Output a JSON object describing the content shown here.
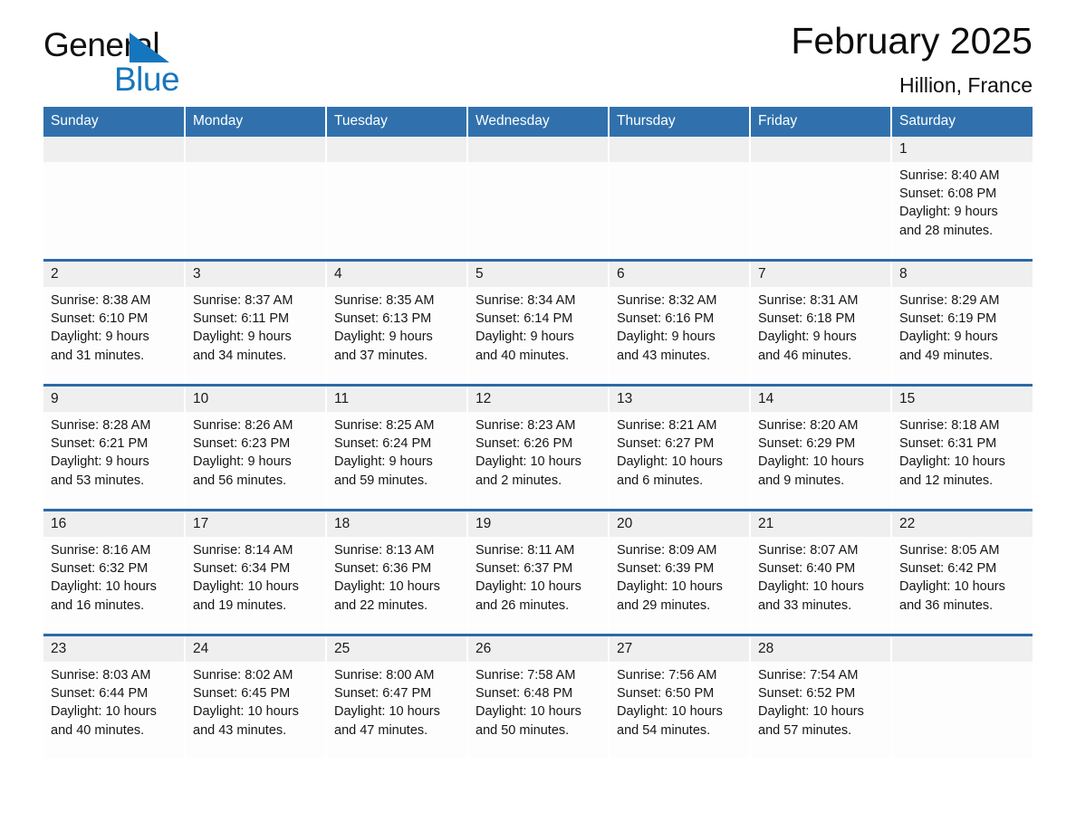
{
  "brand": {
    "name_part1": "General",
    "name_part2": "Blue",
    "triangle_color": "#1676bd"
  },
  "header": {
    "title": "February 2025",
    "subtitle": "Hillion, France",
    "header_bg": "#3071ad",
    "row_divider_color": "#2b6aa8",
    "daynum_bg": "#efefef"
  },
  "weekday_headers": [
    "Sunday",
    "Monday",
    "Tuesday",
    "Wednesday",
    "Thursday",
    "Friday",
    "Saturday"
  ],
  "weeks": [
    [
      {
        "day": "",
        "sunrise": "",
        "sunset": "",
        "daylight_line1": "",
        "daylight_line2": ""
      },
      {
        "day": "",
        "sunrise": "",
        "sunset": "",
        "daylight_line1": "",
        "daylight_line2": ""
      },
      {
        "day": "",
        "sunrise": "",
        "sunset": "",
        "daylight_line1": "",
        "daylight_line2": ""
      },
      {
        "day": "",
        "sunrise": "",
        "sunset": "",
        "daylight_line1": "",
        "daylight_line2": ""
      },
      {
        "day": "",
        "sunrise": "",
        "sunset": "",
        "daylight_line1": "",
        "daylight_line2": ""
      },
      {
        "day": "",
        "sunrise": "",
        "sunset": "",
        "daylight_line1": "",
        "daylight_line2": ""
      },
      {
        "day": "1",
        "sunrise": "Sunrise: 8:40 AM",
        "sunset": "Sunset: 6:08 PM",
        "daylight_line1": "Daylight: 9 hours",
        "daylight_line2": "and 28 minutes."
      }
    ],
    [
      {
        "day": "2",
        "sunrise": "Sunrise: 8:38 AM",
        "sunset": "Sunset: 6:10 PM",
        "daylight_line1": "Daylight: 9 hours",
        "daylight_line2": "and 31 minutes."
      },
      {
        "day": "3",
        "sunrise": "Sunrise: 8:37 AM",
        "sunset": "Sunset: 6:11 PM",
        "daylight_line1": "Daylight: 9 hours",
        "daylight_line2": "and 34 minutes."
      },
      {
        "day": "4",
        "sunrise": "Sunrise: 8:35 AM",
        "sunset": "Sunset: 6:13 PM",
        "daylight_line1": "Daylight: 9 hours",
        "daylight_line2": "and 37 minutes."
      },
      {
        "day": "5",
        "sunrise": "Sunrise: 8:34 AM",
        "sunset": "Sunset: 6:14 PM",
        "daylight_line1": "Daylight: 9 hours",
        "daylight_line2": "and 40 minutes."
      },
      {
        "day": "6",
        "sunrise": "Sunrise: 8:32 AM",
        "sunset": "Sunset: 6:16 PM",
        "daylight_line1": "Daylight: 9 hours",
        "daylight_line2": "and 43 minutes."
      },
      {
        "day": "7",
        "sunrise": "Sunrise: 8:31 AM",
        "sunset": "Sunset: 6:18 PM",
        "daylight_line1": "Daylight: 9 hours",
        "daylight_line2": "and 46 minutes."
      },
      {
        "day": "8",
        "sunrise": "Sunrise: 8:29 AM",
        "sunset": "Sunset: 6:19 PM",
        "daylight_line1": "Daylight: 9 hours",
        "daylight_line2": "and 49 minutes."
      }
    ],
    [
      {
        "day": "9",
        "sunrise": "Sunrise: 8:28 AM",
        "sunset": "Sunset: 6:21 PM",
        "daylight_line1": "Daylight: 9 hours",
        "daylight_line2": "and 53 minutes."
      },
      {
        "day": "10",
        "sunrise": "Sunrise: 8:26 AM",
        "sunset": "Sunset: 6:23 PM",
        "daylight_line1": "Daylight: 9 hours",
        "daylight_line2": "and 56 minutes."
      },
      {
        "day": "11",
        "sunrise": "Sunrise: 8:25 AM",
        "sunset": "Sunset: 6:24 PM",
        "daylight_line1": "Daylight: 9 hours",
        "daylight_line2": "and 59 minutes."
      },
      {
        "day": "12",
        "sunrise": "Sunrise: 8:23 AM",
        "sunset": "Sunset: 6:26 PM",
        "daylight_line1": "Daylight: 10 hours",
        "daylight_line2": "and 2 minutes."
      },
      {
        "day": "13",
        "sunrise": "Sunrise: 8:21 AM",
        "sunset": "Sunset: 6:27 PM",
        "daylight_line1": "Daylight: 10 hours",
        "daylight_line2": "and 6 minutes."
      },
      {
        "day": "14",
        "sunrise": "Sunrise: 8:20 AM",
        "sunset": "Sunset: 6:29 PM",
        "daylight_line1": "Daylight: 10 hours",
        "daylight_line2": "and 9 minutes."
      },
      {
        "day": "15",
        "sunrise": "Sunrise: 8:18 AM",
        "sunset": "Sunset: 6:31 PM",
        "daylight_line1": "Daylight: 10 hours",
        "daylight_line2": "and 12 minutes."
      }
    ],
    [
      {
        "day": "16",
        "sunrise": "Sunrise: 8:16 AM",
        "sunset": "Sunset: 6:32 PM",
        "daylight_line1": "Daylight: 10 hours",
        "daylight_line2": "and 16 minutes."
      },
      {
        "day": "17",
        "sunrise": "Sunrise: 8:14 AM",
        "sunset": "Sunset: 6:34 PM",
        "daylight_line1": "Daylight: 10 hours",
        "daylight_line2": "and 19 minutes."
      },
      {
        "day": "18",
        "sunrise": "Sunrise: 8:13 AM",
        "sunset": "Sunset: 6:36 PM",
        "daylight_line1": "Daylight: 10 hours",
        "daylight_line2": "and 22 minutes."
      },
      {
        "day": "19",
        "sunrise": "Sunrise: 8:11 AM",
        "sunset": "Sunset: 6:37 PM",
        "daylight_line1": "Daylight: 10 hours",
        "daylight_line2": "and 26 minutes."
      },
      {
        "day": "20",
        "sunrise": "Sunrise: 8:09 AM",
        "sunset": "Sunset: 6:39 PM",
        "daylight_line1": "Daylight: 10 hours",
        "daylight_line2": "and 29 minutes."
      },
      {
        "day": "21",
        "sunrise": "Sunrise: 8:07 AM",
        "sunset": "Sunset: 6:40 PM",
        "daylight_line1": "Daylight: 10 hours",
        "daylight_line2": "and 33 minutes."
      },
      {
        "day": "22",
        "sunrise": "Sunrise: 8:05 AM",
        "sunset": "Sunset: 6:42 PM",
        "daylight_line1": "Daylight: 10 hours",
        "daylight_line2": "and 36 minutes."
      }
    ],
    [
      {
        "day": "23",
        "sunrise": "Sunrise: 8:03 AM",
        "sunset": "Sunset: 6:44 PM",
        "daylight_line1": "Daylight: 10 hours",
        "daylight_line2": "and 40 minutes."
      },
      {
        "day": "24",
        "sunrise": "Sunrise: 8:02 AM",
        "sunset": "Sunset: 6:45 PM",
        "daylight_line1": "Daylight: 10 hours",
        "daylight_line2": "and 43 minutes."
      },
      {
        "day": "25",
        "sunrise": "Sunrise: 8:00 AM",
        "sunset": "Sunset: 6:47 PM",
        "daylight_line1": "Daylight: 10 hours",
        "daylight_line2": "and 47 minutes."
      },
      {
        "day": "26",
        "sunrise": "Sunrise: 7:58 AM",
        "sunset": "Sunset: 6:48 PM",
        "daylight_line1": "Daylight: 10 hours",
        "daylight_line2": "and 50 minutes."
      },
      {
        "day": "27",
        "sunrise": "Sunrise: 7:56 AM",
        "sunset": "Sunset: 6:50 PM",
        "daylight_line1": "Daylight: 10 hours",
        "daylight_line2": "and 54 minutes."
      },
      {
        "day": "28",
        "sunrise": "Sunrise: 7:54 AM",
        "sunset": "Sunset: 6:52 PM",
        "daylight_line1": "Daylight: 10 hours",
        "daylight_line2": "and 57 minutes."
      },
      {
        "day": "",
        "sunrise": "",
        "sunset": "",
        "daylight_line1": "",
        "daylight_line2": ""
      }
    ]
  ]
}
